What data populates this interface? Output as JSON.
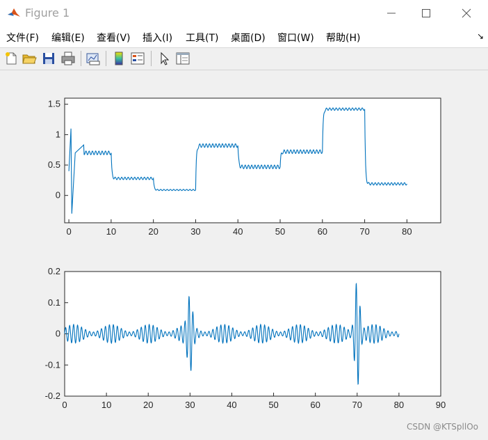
{
  "window": {
    "title": "Figure 1"
  },
  "menu": [
    {
      "label": "文件(F)"
    },
    {
      "label": "编辑(E)"
    },
    {
      "label": "查看(V)"
    },
    {
      "label": "插入(I)"
    },
    {
      "label": "工具(T)"
    },
    {
      "label": "桌面(D)"
    },
    {
      "label": "窗口(W)"
    },
    {
      "label": "帮助(H)"
    }
  ],
  "menu_arrow": "↘",
  "toolbar": [
    "new-figure-icon",
    "open-file-icon",
    "save-icon",
    "print-icon",
    "link-plot-icon",
    "colorbar-icon",
    "legend-icon",
    "pointer-icon",
    "property-editor-icon"
  ],
  "colors": {
    "line": "#0072bd",
    "axes_bg": "#ffffff",
    "figure_bg": "#f0f0f0"
  },
  "watermark": "CSDN @KTSpllOo",
  "chart_data": [
    {
      "type": "line",
      "xlim": [
        -1,
        88
      ],
      "ylim": [
        -0.45,
        1.6
      ],
      "xticks": [
        "0",
        "10",
        "20",
        "30",
        "40",
        "50",
        "60",
        "70",
        "80"
      ],
      "yticks": [
        "0",
        "0.5",
        "1",
        "1.5"
      ],
      "grid": false,
      "segments": [
        {
          "x": [
            0,
            10
          ],
          "level": 0.7,
          "ripple": 0.03
        },
        {
          "x": [
            10,
            20
          ],
          "level": 0.28,
          "ripple": 0.02
        },
        {
          "x": [
            20,
            30
          ],
          "level": 0.09,
          "ripple": 0.01
        },
        {
          "x": [
            30,
            40
          ],
          "level": 0.82,
          "ripple": 0.03
        },
        {
          "x": [
            40,
            50
          ],
          "level": 0.47,
          "ripple": 0.03
        },
        {
          "x": [
            50,
            60
          ],
          "level": 0.72,
          "ripple": 0.03
        },
        {
          "x": [
            60,
            70
          ],
          "level": 1.42,
          "ripple": 0.02
        },
        {
          "x": [
            70,
            80
          ],
          "level": 0.19,
          "ripple": 0.02
        }
      ],
      "initial_transient": {
        "x": [
          0,
          0.5,
          0.7,
          1.5,
          3.5
        ],
        "y": [
          0.4,
          1.1,
          -0.3,
          0.7,
          0.83
        ]
      }
    },
    {
      "type": "line",
      "xlim": [
        0,
        90
      ],
      "ylim": [
        -0.2,
        0.2
      ],
      "xticks": [
        "0",
        "10",
        "20",
        "30",
        "40",
        "50",
        "60",
        "70",
        "80",
        "90"
      ],
      "yticks": [
        "-0.2",
        "-0.1",
        "0",
        "0.1",
        "0.2"
      ],
      "grid": false,
      "x_range": [
        0,
        80
      ],
      "bursts": [
        {
          "x": 30,
          "amplitude": 0.1
        },
        {
          "x": 70,
          "amplitude": 0.17
        }
      ],
      "base_amplitude": 0.03
    }
  ]
}
